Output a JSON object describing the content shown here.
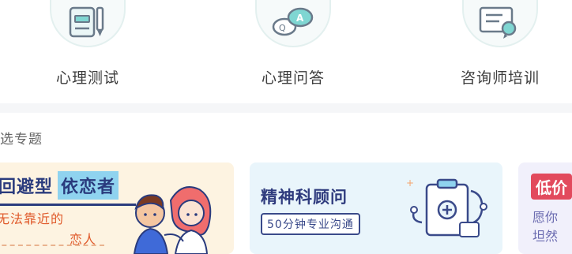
{
  "nav": {
    "items": [
      {
        "label": "心理测试",
        "icon": "test-paper-pencil-icon"
      },
      {
        "label": "心理问答",
        "icon": "chat-bubbles-icon"
      },
      {
        "label": "咨询师培训",
        "icon": "certificate-icon"
      }
    ]
  },
  "section": {
    "title": "选专题"
  },
  "cards": [
    {
      "title_part1": "回避型",
      "title_part2": "依恋者",
      "subtitle_line1": "无法靠近的",
      "subtitle_line2": "恋人"
    },
    {
      "title": "精神科顾问",
      "subtitle": "50分钟专业沟通"
    },
    {
      "badge": "低价",
      "line1": "愿你",
      "line2": "坦然"
    }
  ],
  "colors": {
    "navy": "#2a3b7d",
    "orange_text": "#e05a2b",
    "teal_accent": "#8fd3ef",
    "card_warm": "#fdf3e1",
    "card_blue": "#e9f5fb",
    "card_lavender": "#f1f0fb",
    "badge_red": "#e24a5d"
  }
}
